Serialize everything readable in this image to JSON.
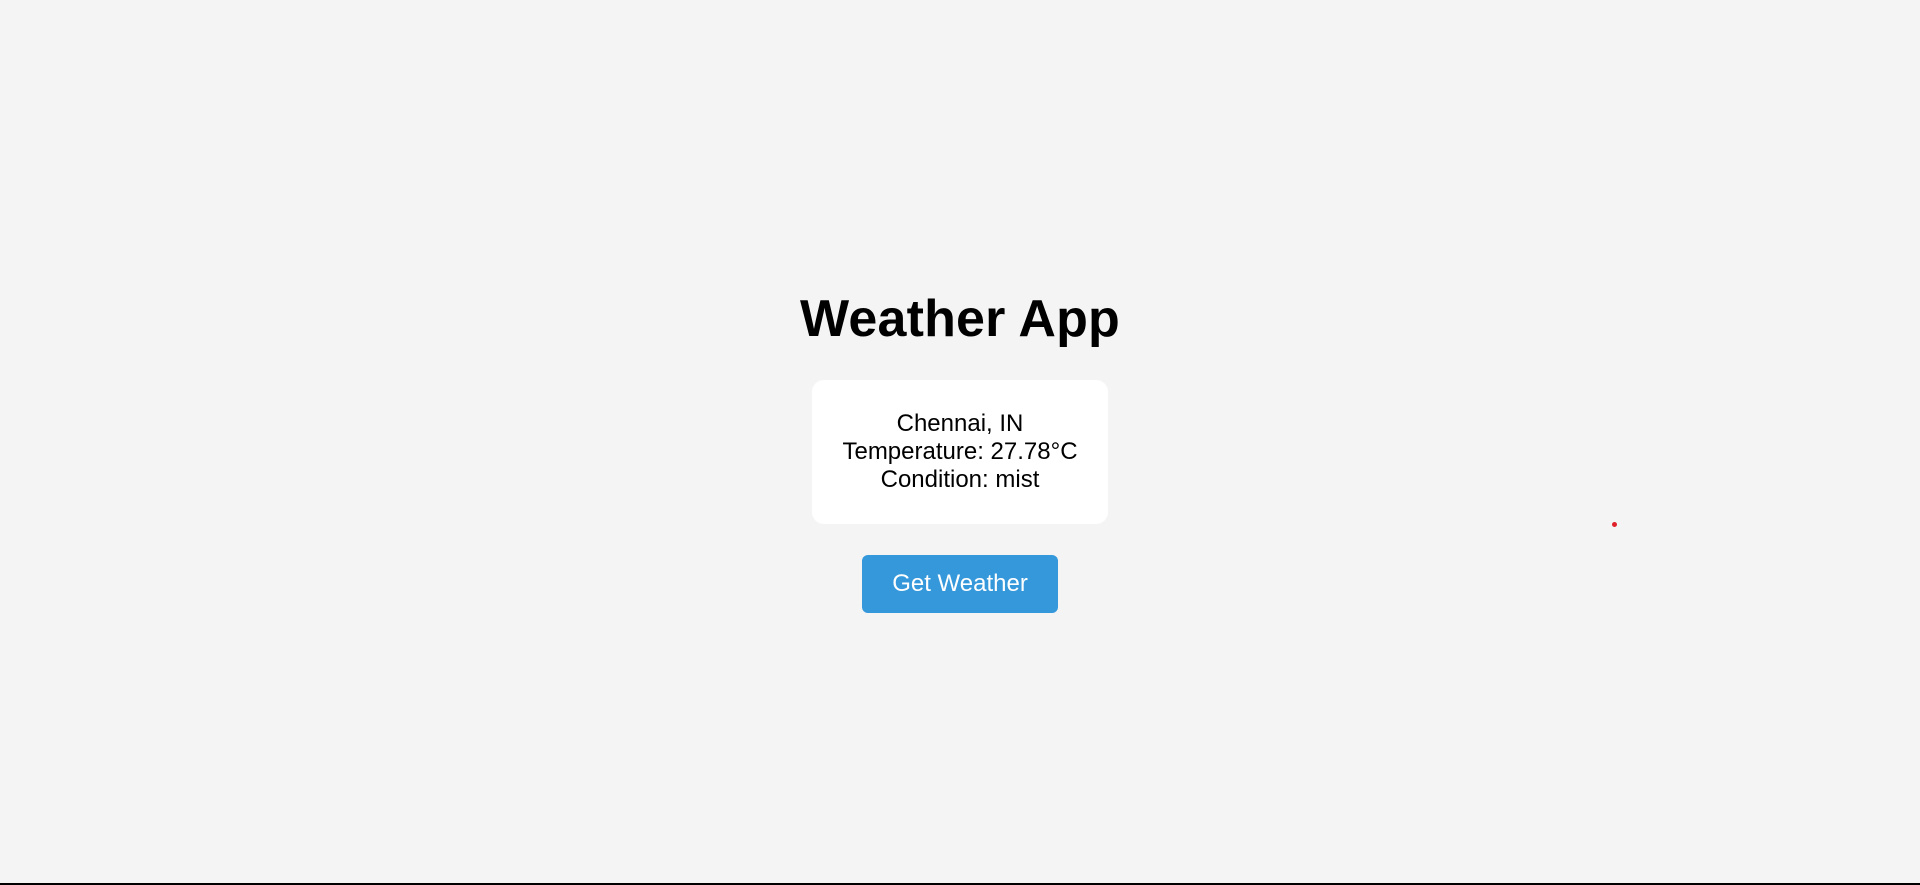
{
  "app": {
    "title": "Weather App"
  },
  "weather": {
    "location": "Chennai, IN",
    "temperature": "Temperature: 27.78°C",
    "condition": "Condition: mist"
  },
  "actions": {
    "get_weather_label": "Get Weather"
  },
  "colors": {
    "background": "#f4f4f4",
    "card": "#ffffff",
    "button": "#3498db",
    "button_text": "#ffffff",
    "cursor_dot": "#e0202a"
  }
}
